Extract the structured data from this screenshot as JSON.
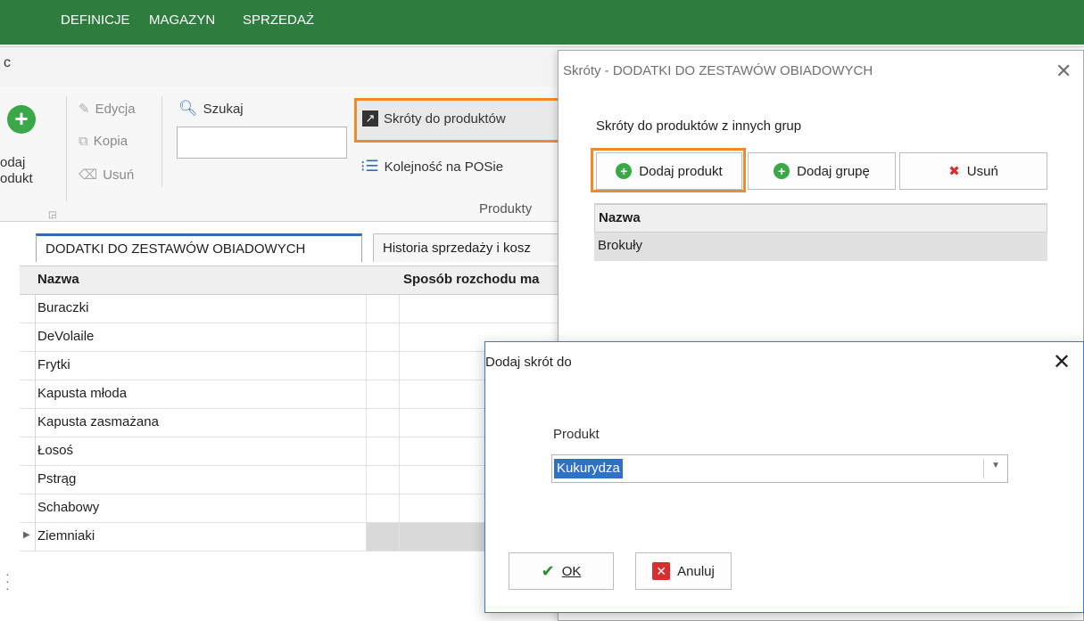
{
  "menu": [
    "DEFINICJE",
    "MAGAZYN",
    "SPRZEDAŻ"
  ],
  "address_glyph": "c",
  "ribbon": {
    "add_product_line1": "odaj",
    "add_product_line2": "odukt",
    "edit": "Edycja",
    "copy": "Kopia",
    "delete": "Usuń",
    "search": "Szukaj",
    "shortcuts": "Skróty do produktów",
    "pos_order": "Kolejność na POSie",
    "group_products": "Produkty"
  },
  "tabs": [
    "DODATKI DO ZESTAWÓW OBIADOWYCH",
    "Historia sprzedaży i kosz"
  ],
  "grid": {
    "columns": [
      "Nazwa",
      "Sposób rozchodu ma"
    ],
    "rows": [
      "Buraczki",
      "DeVolaile",
      "Frytki",
      "Kapusta młoda",
      "Kapusta zasmażana",
      "Łosoś",
      "Pstrąg",
      "Schabowy",
      "Ziemniaki"
    ],
    "current_row": 8
  },
  "shortcuts_dialog": {
    "title": "Skróty - DODATKI DO ZESTAWÓW OBIADOWYCH",
    "heading": "Skróty do produktów z innych grup",
    "add_product": "Dodaj produkt",
    "add_group": "Dodaj grupę",
    "delete": "Usuń",
    "column": "Nazwa",
    "rows": [
      "Brokuły"
    ]
  },
  "add_shortcut_dialog": {
    "title": "Dodaj skrót do",
    "label": "Produkt",
    "value": "Kukurydza",
    "ok": "OK",
    "cancel": "Anuluj"
  },
  "colors": {
    "menubar": "#2e7d3e",
    "highlight": "#f28a2c",
    "selection": "#2f70c8"
  }
}
